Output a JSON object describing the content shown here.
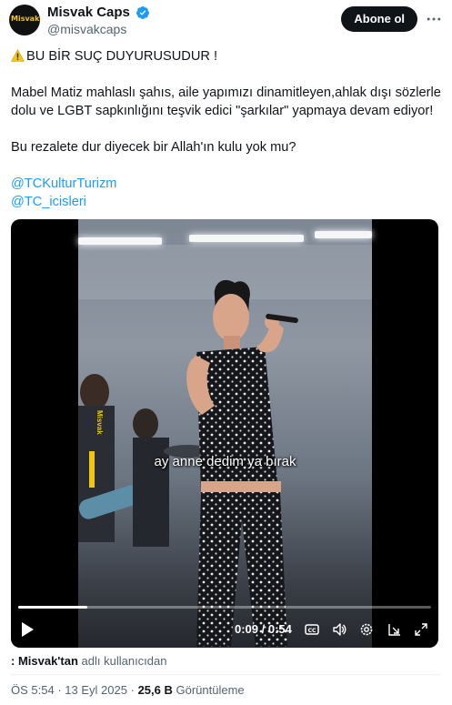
{
  "author": {
    "display_name": "Misvak Caps",
    "handle": "@misvakcaps",
    "avatar_label": "Misvak"
  },
  "follow_label": "Abone ol",
  "more_icon": "more-horizontal-icon",
  "verified_color": "#1d9bf0",
  "tweet": {
    "line1": "BU BİR SUÇ DUYURUSUDUR !",
    "line2": "Mabel Matiz mahlaslı şahıs, aile yapımızı dinamitleyen,ahlak dışı sözlerle dolu ve LGBT sapkınlığını teşvik edici \"şarkılar\" yapmaya devam ediyor!",
    "line3": "Bu rezalete dur diyecek bir Allah'ın kulu yok mu?",
    "mentions": [
      "@TCKulturTurizm",
      "@TC_icisleri"
    ]
  },
  "video": {
    "watermark": "Misvak",
    "caption": "ay anne dedim ya bırak",
    "time": "0:09 / 0:54",
    "progress": 0.167,
    "controls": [
      "play-icon",
      "cc-icon",
      "volume-icon",
      "settings-icon",
      "pip-icon",
      "fullscreen-icon"
    ]
  },
  "attribution": {
    "user": ": Misvak'tan",
    "rest": "adlı kullanıcıdan"
  },
  "meta": {
    "time": "ÖS 5:54",
    "sep": "·",
    "date": "13 Eyl 2025",
    "views": "25,6 B",
    "views_label": "Görüntüleme"
  }
}
